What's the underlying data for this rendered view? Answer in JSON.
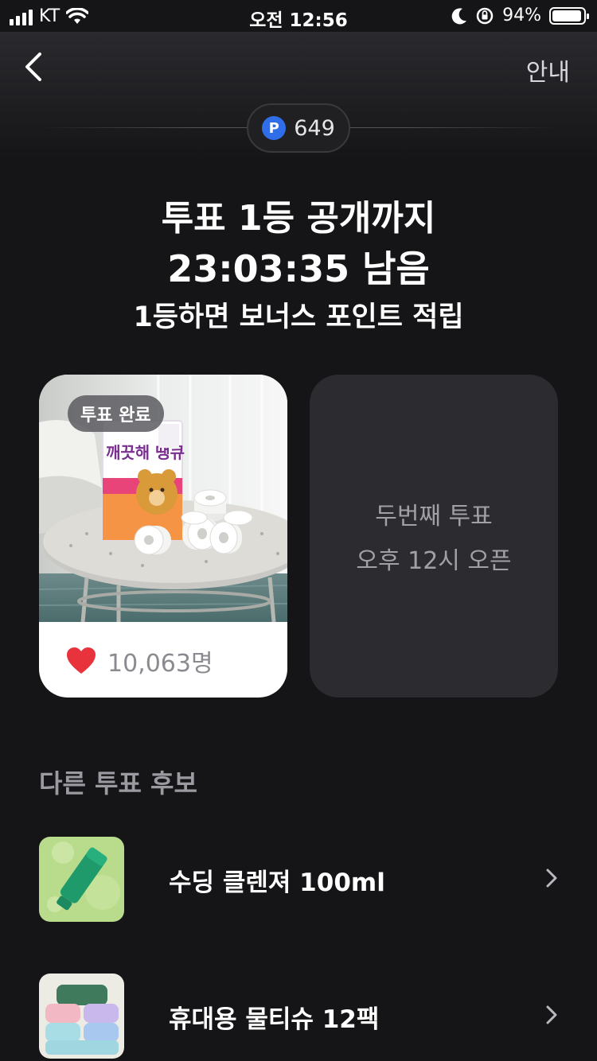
{
  "status_bar": {
    "carrier": "KT",
    "time": "오전 12:56",
    "battery": "94%",
    "battery_level": 0.94
  },
  "header": {
    "back_icon": "chevron-left-icon",
    "guide_label": "안내",
    "points": "649",
    "points_icon_letter": "P"
  },
  "hero": {
    "line1": "투표 1등 공개까지",
    "line2": "23:03:35 남음",
    "line3": "1등하면 보너스 포인트 적립"
  },
  "vote_card": {
    "badge": "투표 완료",
    "likes": "10,063명",
    "product_label": "깨끗해 땡큐",
    "like_icon": "heart-icon"
  },
  "next_vote": {
    "line1": "두번째 투표",
    "line2": "오후 12시 오픈"
  },
  "candidates": {
    "title": "다른 투표 후보",
    "items": [
      {
        "name": "수딩 클렌져 100ml"
      },
      {
        "name": "휴대용 물티슈 12팩"
      }
    ]
  },
  "colors": {
    "background": "#151517",
    "card_dark": "#2b2b30",
    "points_icon": "#2f6ee8",
    "heart": "#e8323c"
  }
}
